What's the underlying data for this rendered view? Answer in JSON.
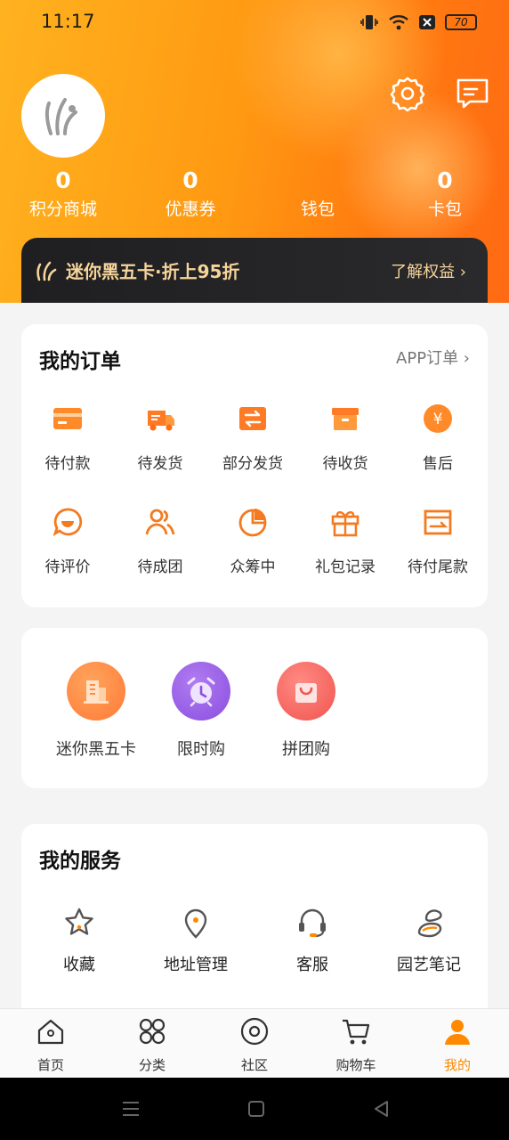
{
  "status": {
    "time": "11:17",
    "battery": "70"
  },
  "stats": [
    {
      "num": "0",
      "label": "积分商城"
    },
    {
      "num": "0",
      "label": "优惠券"
    },
    {
      "num": "",
      "label": "钱包"
    },
    {
      "num": "0",
      "label": "卡包"
    }
  ],
  "banner": {
    "title": "迷你黑五卡·折上95折",
    "link": "了解权益 ›"
  },
  "orders": {
    "title": "我的订单",
    "more": "APP订单 ›",
    "items": [
      "待付款",
      "待发货",
      "部分发货",
      "待收货",
      "售后",
      "待评价",
      "待成团",
      "众筹中",
      "礼包记录",
      "待付尾款"
    ]
  },
  "promos": {
    "items": [
      "迷你黑五卡",
      "限时购",
      "拼团购"
    ]
  },
  "services": {
    "title": "我的服务",
    "items": [
      "收藏",
      "地址管理",
      "客服",
      "园艺笔记"
    ]
  },
  "tabs": [
    "首页",
    "分类",
    "社区",
    "购物车",
    "我的"
  ],
  "colors": {
    "accent": "#ff8a00",
    "orange_icon": "#f47a1f",
    "banner_gold": "#f7d49a"
  }
}
